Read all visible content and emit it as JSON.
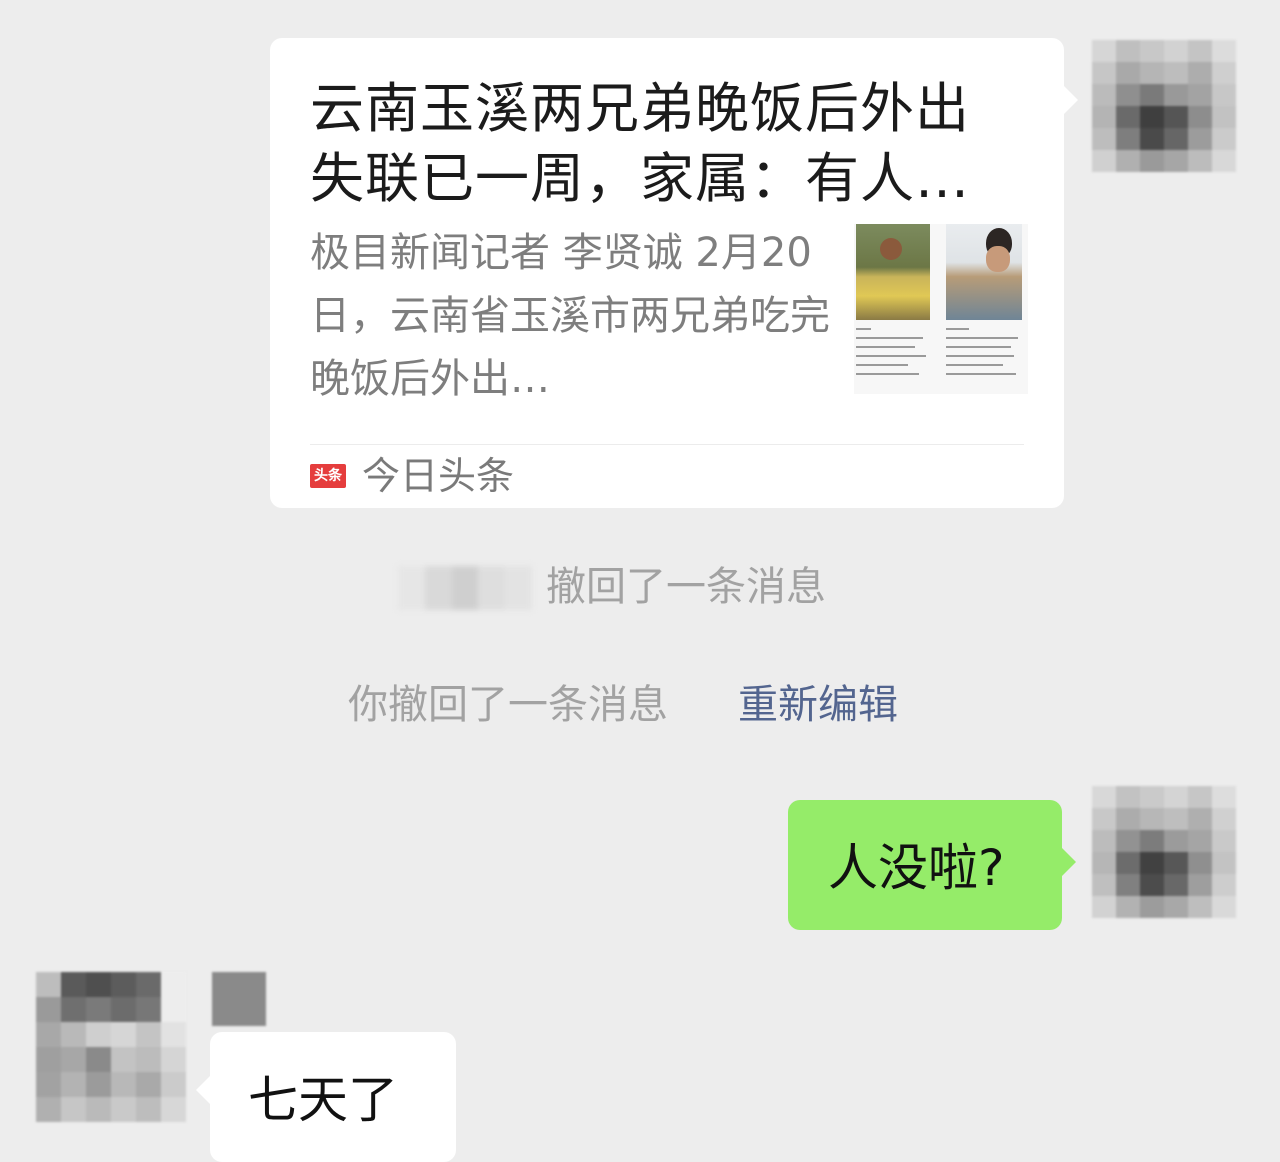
{
  "chat": {
    "link_card": {
      "title": "云南玉溪两兄弟晚饭后外出失联已一周，家属：有人…",
      "description": "极目新闻记者 李贤诚 2月20日，云南省玉溪市两兄弟吃完晚饭后外出…",
      "source_icon_text": "头条",
      "source_name": "今日头条",
      "thumbnail_icon": "news-thumbnail-icon"
    },
    "notices": {
      "peer_recalled": "撤回了一条消息",
      "self_recalled": "你撤回了一条消息",
      "reedit_label": "重新编辑"
    },
    "messages": {
      "outgoing_text": "人没啦?",
      "incoming_text": "七天了"
    }
  },
  "colors": {
    "background": "#ededed",
    "outgoing_bubble": "#95ec69",
    "incoming_bubble": "#ffffff",
    "link_text": "#53658f",
    "source_icon": "#e53d3d"
  }
}
